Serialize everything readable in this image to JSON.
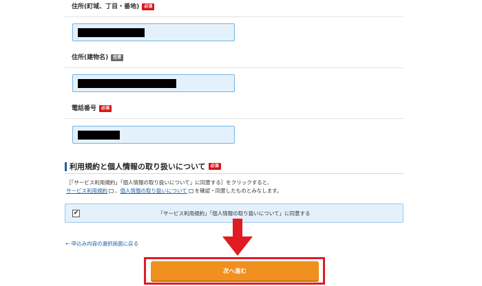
{
  "form": {
    "address_street": {
      "label": "住所(町域、丁目・番地)",
      "badge": "必須"
    },
    "address_building": {
      "label": "住所(建物名)",
      "badge": "任意"
    },
    "phone": {
      "label": "電話番号",
      "badge": "必須"
    }
  },
  "terms": {
    "title": "利用規約と個人情報の取り扱いについて",
    "badge": "必須",
    "line1": "［「サービス利用規約」「個人情報の取り扱いについて」に同意する］をクリックすると、",
    "link_service": "サービス利用規約",
    "sep": "、",
    "link_privacy": "個人情報の取り扱いについて",
    "line2_suffix": "を確認・同意したものとみなします。",
    "agree_label": "「サービス利用規約」「個人情報の取り扱いについて」に同意する",
    "checkmark": "✔"
  },
  "nav": {
    "back_link": "← 申込み内容の選択画面に戻る",
    "next_button": "次へ進む"
  },
  "colors": {
    "accent": "#1a5fa6",
    "required": "#d9141a",
    "button": "#f0901e",
    "highlight": "#e01b22"
  }
}
